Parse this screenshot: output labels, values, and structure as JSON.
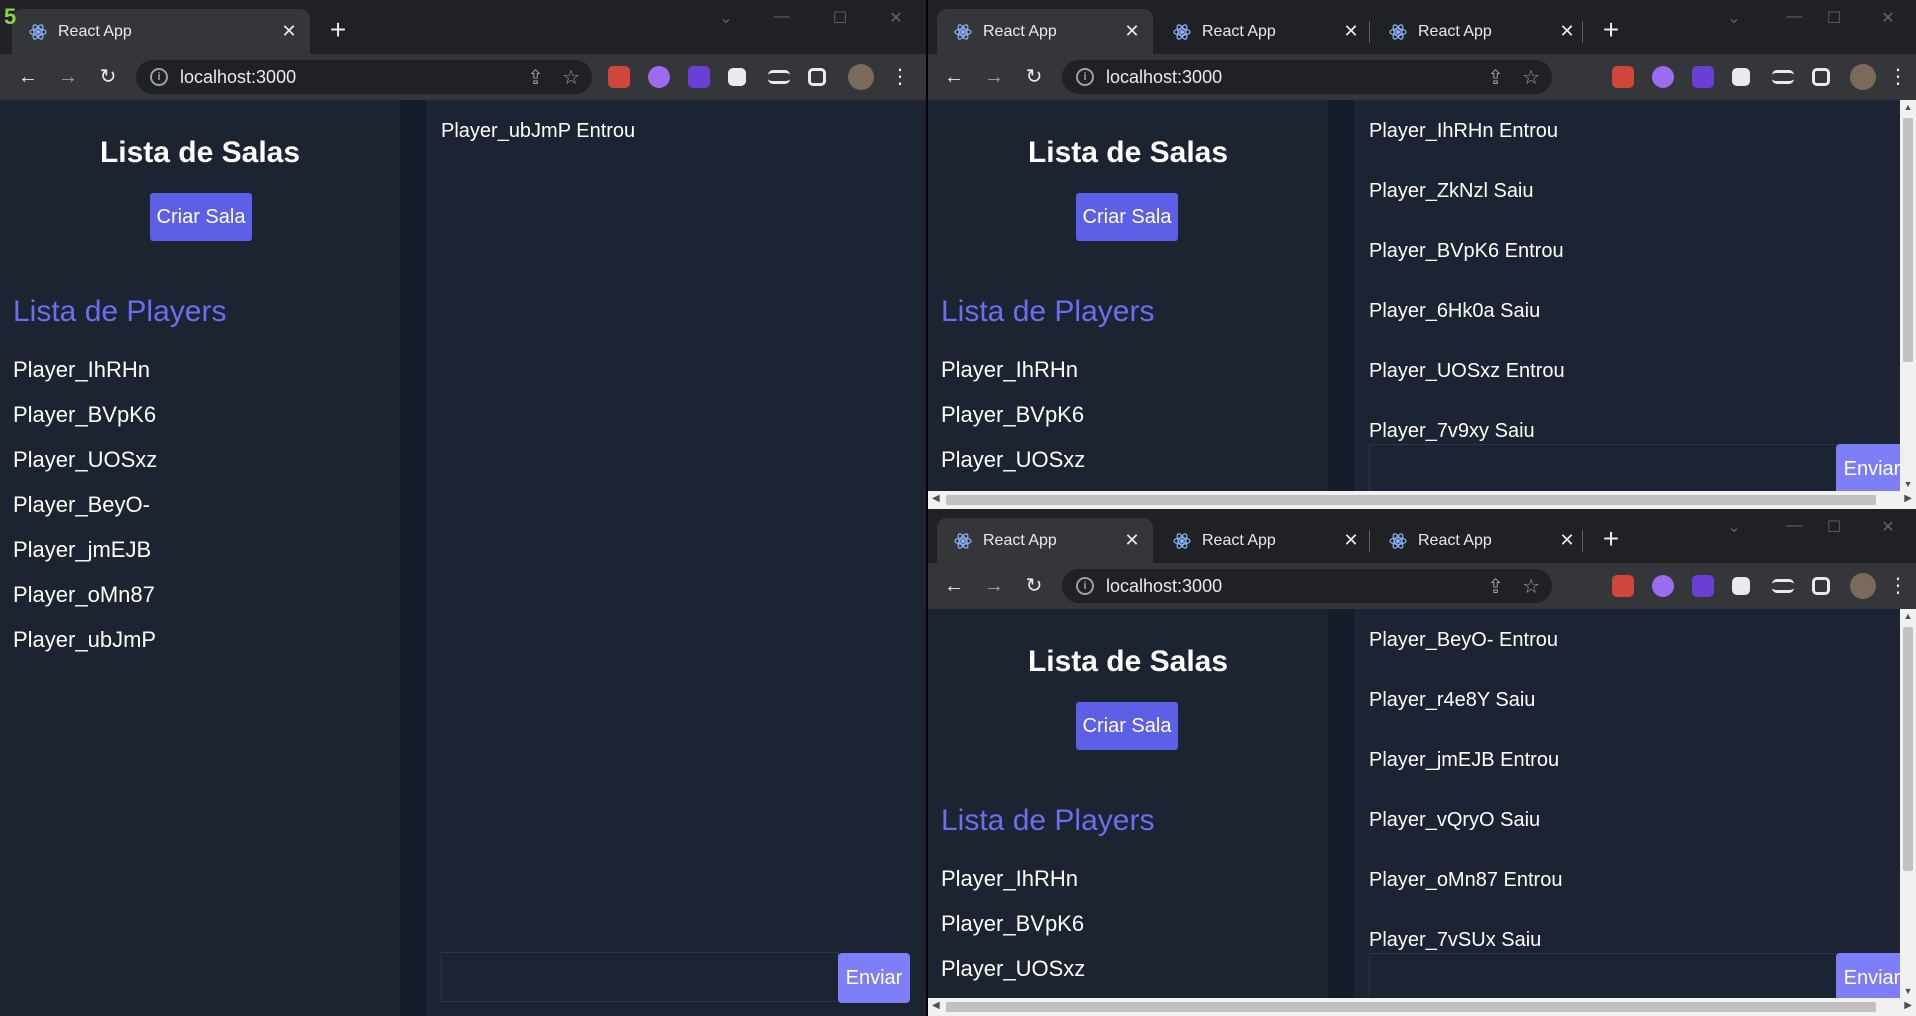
{
  "frame_number": "5",
  "browser": {
    "tab_title": "React App",
    "url": "localhost:3000",
    "close_glyph": "✕",
    "new_tab_glyph": "+",
    "back_glyph": "←",
    "forward_glyph": "→",
    "reload_glyph": "↻",
    "menu_glyph": "⋮",
    "share_glyph": "⇪",
    "star_glyph": "☆",
    "minimize_glyph": "—",
    "maximize_glyph": "☐",
    "tabsearch_glyph": "⌄"
  },
  "app": {
    "rooms_title": "Lista de Salas",
    "create_room_label": "Criar Sala",
    "players_title": "Lista de Players",
    "send_label": "Enviar"
  },
  "windows": {
    "left": {
      "players": [
        "Player_IhRHn",
        "Player_BVpK6",
        "Player_UOSxz",
        "Player_BeyO-",
        "Player_jmEJB",
        "Player_oMn87",
        "Player_ubJmP"
      ],
      "messages": [
        "Player_ubJmP Entrou"
      ]
    },
    "top_right": {
      "players": [
        "Player_IhRHn",
        "Player_BVpK6",
        "Player_UOSxz"
      ],
      "messages": [
        "Player_IhRHn Entrou",
        "Player_ZkNzl Saiu",
        "Player_BVpK6 Entrou",
        "Player_6Hk0a Saiu",
        "Player_UOSxz Entrou",
        "Player_7v9xy Saiu"
      ]
    },
    "bottom_right": {
      "players": [
        "Player_IhRHn",
        "Player_BVpK6",
        "Player_UOSxz"
      ],
      "messages": [
        "Player_BeyO- Entrou",
        "Player_r4e8Y Saiu",
        "Player_jmEJB Entrou",
        "Player_vQryO Saiu",
        "Player_oMn87 Entrou",
        "Player_7vSUx Saiu"
      ]
    }
  },
  "colors": {
    "accent_button": "#5d5fe6",
    "send_button": "#7d7ef8",
    "players_title": "#6b6ef0",
    "background": "#1c2433"
  }
}
